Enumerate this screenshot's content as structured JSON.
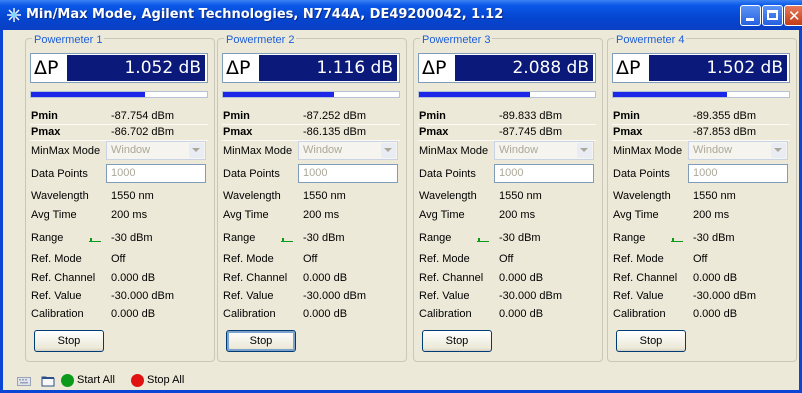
{
  "window": {
    "title": "Min/Max Mode, Agilent Technologies, N7744A, DE49200042, 1.12"
  },
  "colors": {
    "titlebar": "#0545d0",
    "delta_value_bg": "#0b1a7a",
    "bar_fill": "#1d27e8",
    "start_all": "#0b9a1a",
    "stop_all": "#e01212"
  },
  "labels": {
    "pmin": "Pmin",
    "pmax": "Pmax",
    "minmax_mode": "MinMax Mode",
    "data_points": "Data Points",
    "wavelength": "Wavelength",
    "avg_time": "Avg Time",
    "range": "Range",
    "ref_mode": "Ref. Mode",
    "ref_channel": "Ref. Channel",
    "ref_value": "Ref. Value",
    "calibration": "Calibration"
  },
  "panels": [
    {
      "title": "Powermeter 1",
      "delta_label": "ΔP",
      "delta_value": "1.052 dB",
      "bar_level": 0.65,
      "pmin": "-87.754 dBm",
      "pmax": "-86.702 dBm",
      "minmax_mode": "Window",
      "data_points": "1000",
      "wavelength": "1550 nm",
      "avg_time": "200 ms",
      "range": "-30 dBm",
      "ref_mode": "Off",
      "ref_channel": "0.000 dB",
      "ref_value": "-30.000 dBm",
      "calibration": "0.000 dB",
      "stop_label": "Stop"
    },
    {
      "title": "Powermeter 2",
      "delta_label": "ΔP",
      "delta_value": "1.116 dB",
      "bar_level": 0.63,
      "pmin": "-87.252 dBm",
      "pmax": "-86.135 dBm",
      "minmax_mode": "Window",
      "data_points": "1000",
      "wavelength": "1550 nm",
      "avg_time": "200 ms",
      "range": "-30 dBm",
      "ref_mode": "Off",
      "ref_channel": "0.000 dB",
      "ref_value": "-30.000 dBm",
      "calibration": "0.000 dB",
      "stop_label": "Stop"
    },
    {
      "title": "Powermeter 3",
      "delta_label": "ΔP",
      "delta_value": "2.088 dB",
      "bar_level": 0.63,
      "pmin": "-89.833 dBm",
      "pmax": "-87.745 dBm",
      "minmax_mode": "Window",
      "data_points": "1000",
      "wavelength": "1550 nm",
      "avg_time": "200 ms",
      "range": "-30 dBm",
      "ref_mode": "Off",
      "ref_channel": "0.000 dB",
      "ref_value": "-30.000 dBm",
      "calibration": "0.000 dB",
      "stop_label": "Stop"
    },
    {
      "title": "Powermeter 4",
      "delta_label": "ΔP",
      "delta_value": "1.502 dB",
      "bar_level": 0.65,
      "pmin": "-89.355 dBm",
      "pmax": "-87.853 dBm",
      "minmax_mode": "Window",
      "data_points": "1000",
      "wavelength": "1550 nm",
      "avg_time": "200 ms",
      "range": "-30 dBm",
      "ref_mode": "Off",
      "ref_channel": "0.000 dB",
      "ref_value": "-30.000 dBm",
      "calibration": "0.000 dB",
      "stop_label": "Stop"
    }
  ],
  "statusbar": {
    "start_all_label": "Start All",
    "stop_all_label": "Stop All"
  }
}
